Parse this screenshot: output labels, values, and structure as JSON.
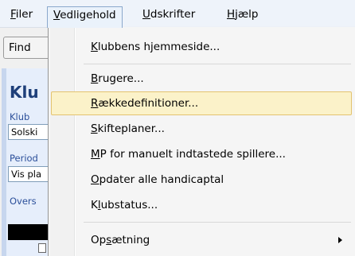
{
  "menubar": {
    "items": [
      {
        "pre": "",
        "key": "F",
        "post": "iler"
      },
      {
        "pre": "",
        "key": "V",
        "post": "edligehold"
      },
      {
        "pre": "",
        "key": "U",
        "post": "dskrifter"
      },
      {
        "pre": "",
        "key": "H",
        "post": "jælp"
      }
    ]
  },
  "background": {
    "find_label": "Find",
    "panel_title": "Klu",
    "klub_label": "Klub",
    "klub_value": "Solski",
    "period_label": "Period",
    "period_value": "Vis pla",
    "overs_label": "Overs"
  },
  "menu": {
    "items": [
      {
        "pre": "",
        "key": "K",
        "post": "lubbens hjemmeside..."
      },
      {
        "pre": "",
        "key": "B",
        "post": "rugere..."
      },
      {
        "pre": "",
        "key": "R",
        "post": "ækkedefinitioner..."
      },
      {
        "pre": "",
        "key": "S",
        "post": "kifteplaner..."
      },
      {
        "pre": "",
        "key": "M",
        "post": "P for manuelt indtastede spillere..."
      },
      {
        "pre": "",
        "key": "O",
        "post": "pdater alle handicaptal"
      },
      {
        "pre": "K",
        "key": "l",
        "post": "ubstatus..."
      },
      {
        "pre": "Op",
        "key": "s",
        "post": "ætning"
      }
    ],
    "highlighted_index": 2
  }
}
